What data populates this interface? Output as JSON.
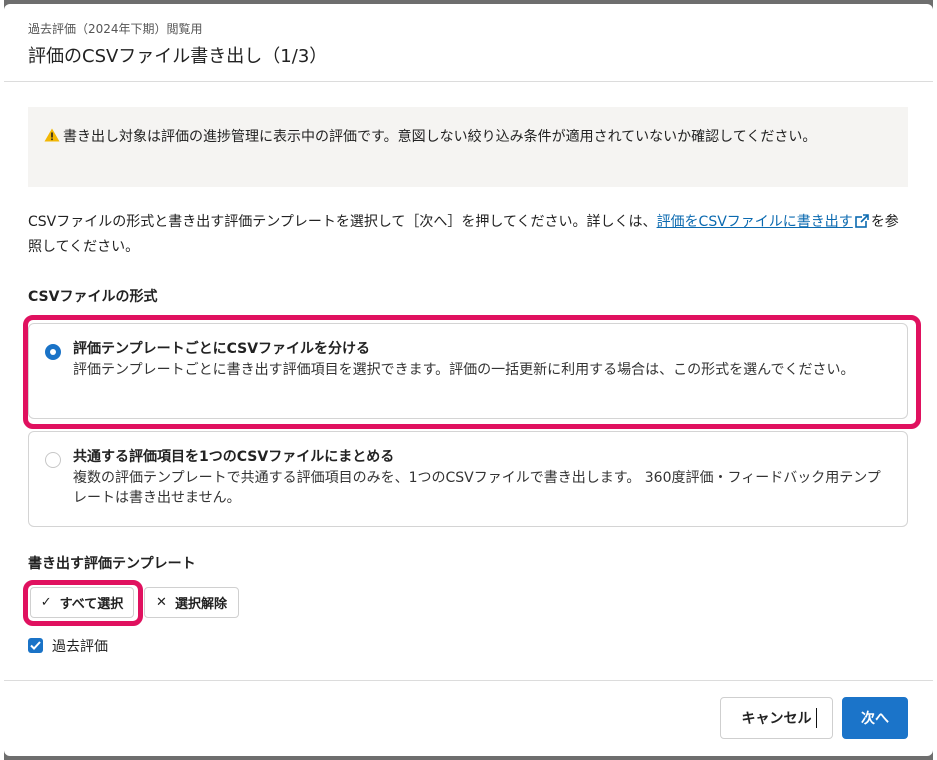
{
  "dialog": {
    "subtitle": "過去評価（2024年下期）閲覧用",
    "title": "評価のCSVファイル書き出し（1/3）"
  },
  "notice": {
    "icon": "warning-icon",
    "text": "書き出し対象は評価の進捗管理に表示中の評価です。意図しない絞り込み条件が適用されていないか確認してください。"
  },
  "description": {
    "text_before": "CSVファイルの形式と書き出す評価テンプレートを選択して［次へ］を押してください。詳しくは、",
    "link_text": "評価をCSVファイルに書き出す",
    "text_after": "を参照してください。"
  },
  "format_section": {
    "label": "CSVファイルの形式",
    "options": [
      {
        "title": "評価テンプレートごとにCSVファイルを分ける",
        "description": "評価テンプレートごとに書き出す評価項目を選択できます。評価の一括更新に利用する場合は、この形式を選んでください。",
        "selected": true
      },
      {
        "title": "共通する評価項目を1つのCSVファイルにまとめる",
        "description": "複数の評価テンプレートで共通する評価項目のみを、1つのCSVファイルで書き出します。 360度評価・フィードバック用テンプレートは書き出せません。",
        "selected": false
      }
    ]
  },
  "template_section": {
    "label": "書き出す評価テンプレート",
    "select_all_label": "すべて選択",
    "deselect_label": "選択解除",
    "templates": [
      {
        "label": "過去評価",
        "checked": true
      }
    ]
  },
  "footer": {
    "cancel_label": "キャンセル",
    "next_label": "次へ"
  },
  "colors": {
    "accent": "#1b74c9",
    "highlight": "#e0115f",
    "notice_bg": "#f5f4f2",
    "link": "#0b6ab0"
  }
}
